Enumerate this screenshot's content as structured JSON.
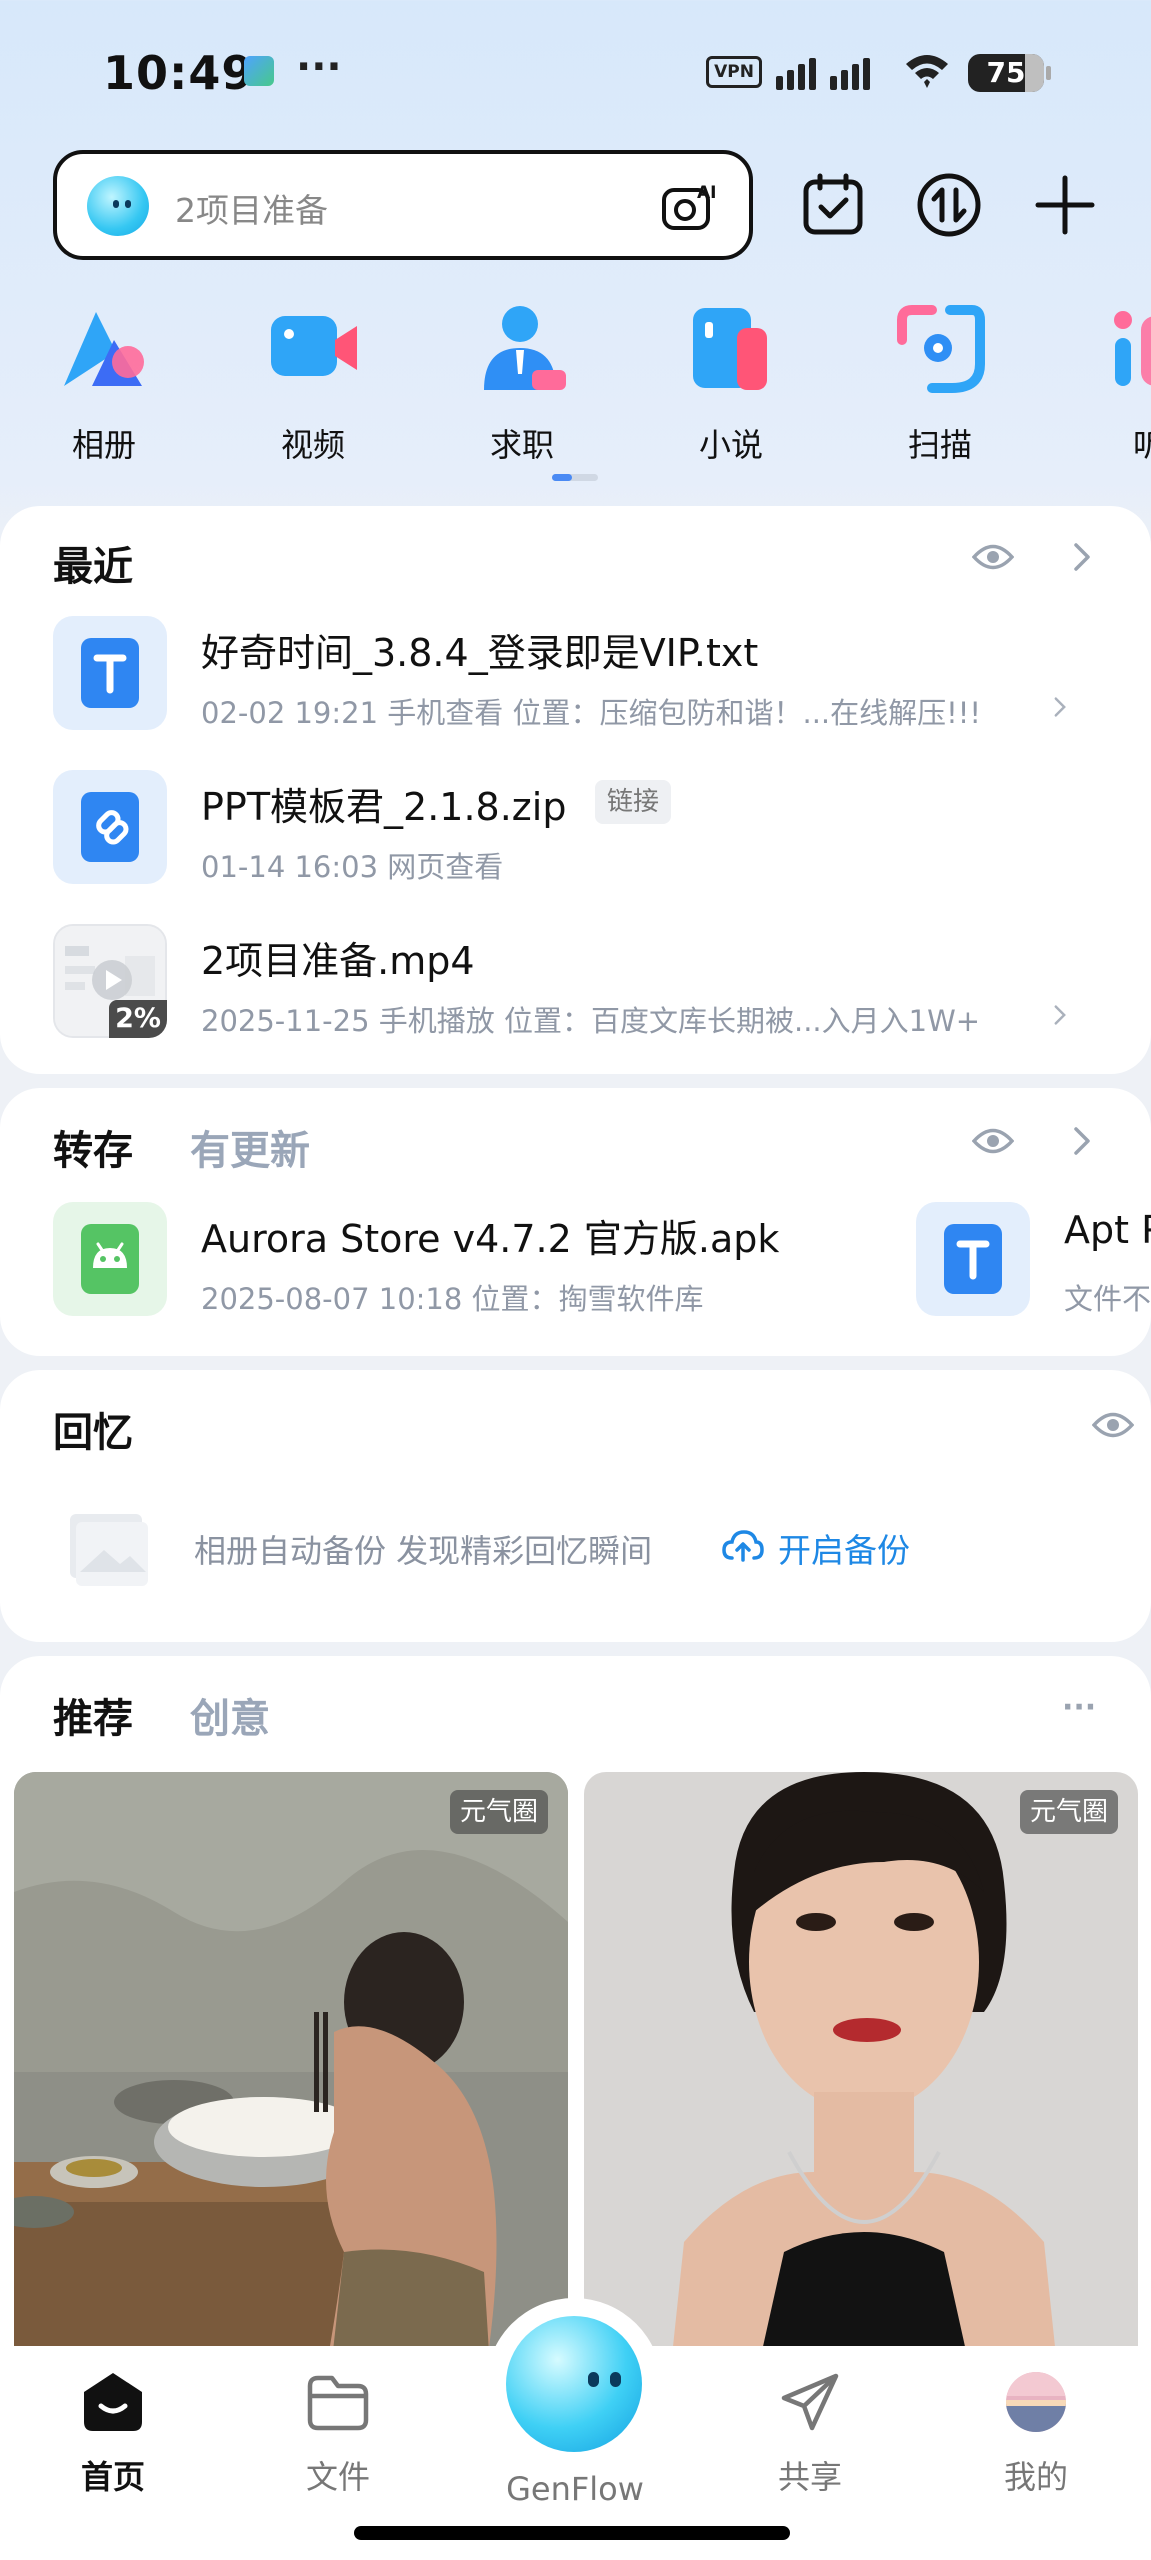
{
  "status_bar": {
    "time": "10:49",
    "more": "···",
    "vpn": "VPN",
    "battery": "75",
    "battery_level_percent": 75
  },
  "search": {
    "placeholder": "2项目准备"
  },
  "top_actions": [
    {
      "icon": "calendar-check-icon"
    },
    {
      "icon": "sync-transfer-icon"
    },
    {
      "icon": "plus-icon"
    }
  ],
  "quick_apps": [
    {
      "label": "相册",
      "icon": "album-icon"
    },
    {
      "label": "视频",
      "icon": "video-icon"
    },
    {
      "label": "求职",
      "icon": "job-icon"
    },
    {
      "label": "小说",
      "icon": "novel-icon"
    },
    {
      "label": "扫描",
      "icon": "scan-icon"
    },
    {
      "label": "听",
      "icon": "listen-icon"
    }
  ],
  "recent": {
    "title": "最近",
    "items": [
      {
        "name": "好奇时间_3.8.4_登录即是VIP.txt",
        "meta": "02-02 19:21  手机查看  位置：压缩包防和谐！...在线解压!!!",
        "icon": "txt-file-icon"
      },
      {
        "name": "PPT模板君_2.1.8.zip",
        "tag": "链接",
        "meta": "01-14 16:03  网页查看",
        "icon": "link-file-icon"
      },
      {
        "name": "2项目准备.mp4",
        "meta": "2025-11-25  手机播放  位置：百度文库长期被...入月入1W+",
        "progress": "2%",
        "icon": "video-thumbnail-icon"
      }
    ]
  },
  "transfer": {
    "title": "转存",
    "subtitle": "有更新",
    "items": [
      {
        "name": "Aurora Store v4.7.2 官方版.apk",
        "meta": "2025-08-07 10:18  位置：掏雪软件库",
        "icon": "apk-file-icon"
      },
      {
        "name": "Apt P",
        "meta": "文件不",
        "icon": "txt-file-icon"
      }
    ]
  },
  "memories": {
    "title": "回忆",
    "text": "相册自动备份 发现精彩回忆瞬间",
    "action": "开启备份"
  },
  "recommend": {
    "title": "推荐",
    "subtitle": "创意",
    "cards": [
      {
        "badge": "元气圈",
        "image": "photo-boy-eating-rice"
      },
      {
        "badge": "元气圈",
        "image": "photo-woman-portrait"
      }
    ]
  },
  "bottom_nav": [
    {
      "label": "首页",
      "icon": "home-icon",
      "active": true
    },
    {
      "label": "文件",
      "icon": "folder-icon"
    },
    {
      "label": "GenFlow",
      "icon": "genflow-ball-icon"
    },
    {
      "label": "共享",
      "icon": "share-icon"
    },
    {
      "label": "我的",
      "icon": "profile-avatar-icon"
    }
  ],
  "colors": {
    "accent": "#1e88e5",
    "card": "#ffffff",
    "muted": "#9098a6"
  }
}
